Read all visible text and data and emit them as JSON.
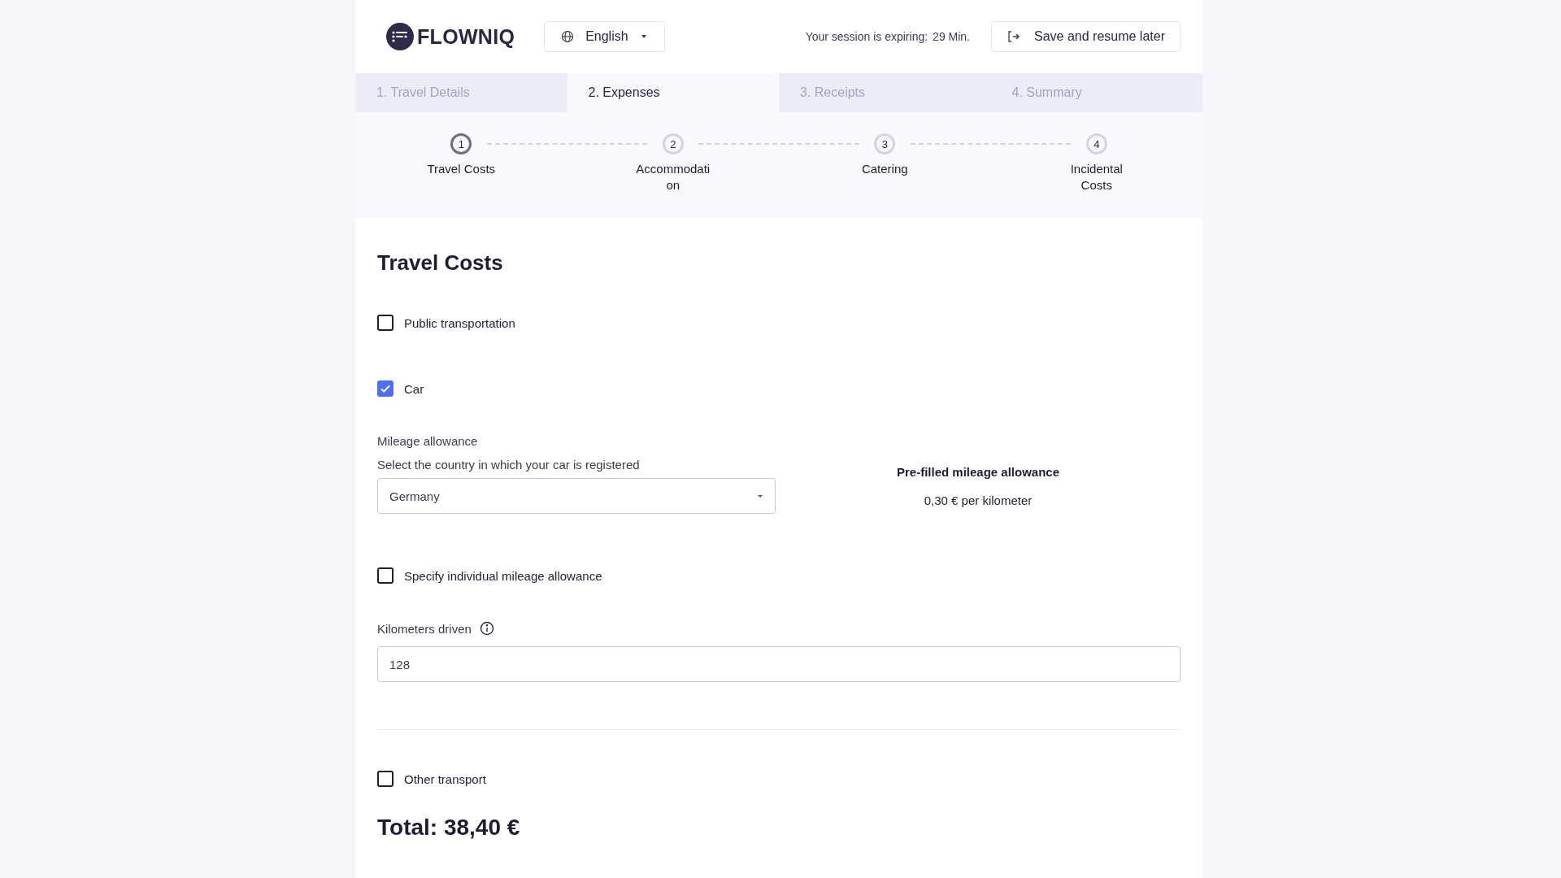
{
  "header": {
    "logo_text": "FLOWNIQ",
    "language": "English",
    "session_label": "Your session is expiring:",
    "session_time": "29 Min.",
    "save_button": "Save and resume later"
  },
  "tabs": [
    {
      "label": "1. Travel Details",
      "selected": false
    },
    {
      "label": "2. Expenses",
      "selected": true
    },
    {
      "label": "3. Receipts",
      "selected": false
    },
    {
      "label": "4. Summary",
      "selected": false
    }
  ],
  "steps": [
    {
      "number": "1",
      "label": "Travel Costs",
      "selected": true
    },
    {
      "number": "2",
      "label": "Accommodation",
      "selected": false
    },
    {
      "number": "3",
      "label": "Catering",
      "selected": false
    },
    {
      "number": "4",
      "label": "Incidental Costs",
      "selected": false
    }
  ],
  "section_title": "Travel Costs",
  "public_transport": {
    "label": "Public transportation",
    "checked": false
  },
  "car": {
    "label": "Car",
    "checked": true
  },
  "mileage": {
    "heading": "Mileage allowance",
    "country_label": "Select the country in which your car is registered",
    "country_value": "Germany",
    "prefilled_title": "Pre-filled mileage allowance",
    "prefilled_value": "0,30 € per kilometer"
  },
  "individual_allowance": {
    "label": "Specify individual mileage allowance",
    "checked": false
  },
  "kilometers": {
    "label": "Kilometers driven",
    "value": "128"
  },
  "other_transport": {
    "label": "Other transport",
    "checked": false
  },
  "total": "Total: 38,40 €"
}
